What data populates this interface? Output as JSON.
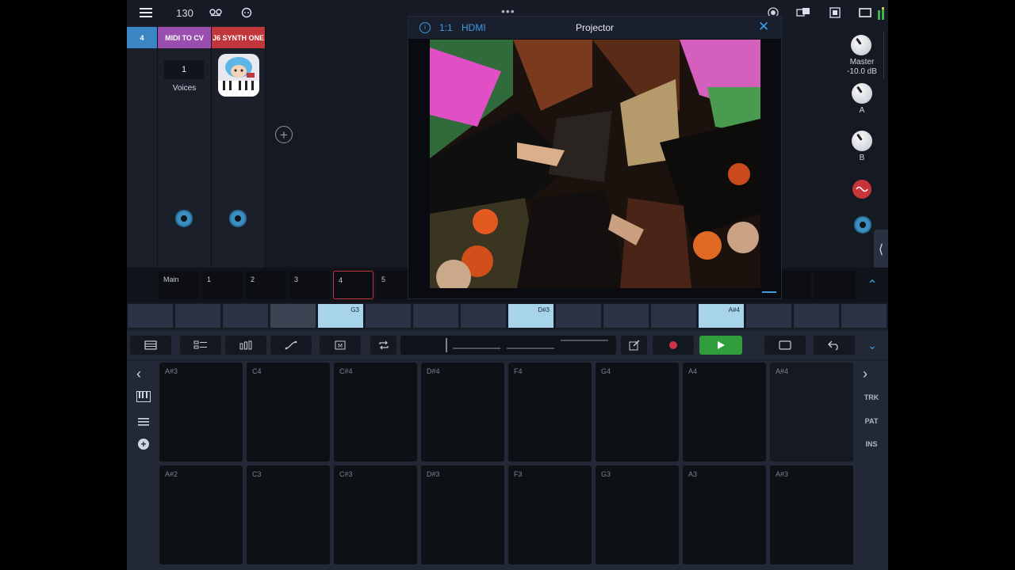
{
  "topbar": {
    "tempo": "130",
    "icons": [
      "menu-icon",
      "tape-icon",
      "clock-icon",
      "drag-handle-icon",
      "record-icon",
      "link-icon",
      "stop-icon",
      "window-icon",
      "meter-icon"
    ]
  },
  "mixer": {
    "strips": [
      {
        "header": "4",
        "color": "#3a86c3"
      },
      {
        "header": "MIDI TO CV",
        "color": "#9a4eb0"
      },
      {
        "header": "J6 SYNTH ONE",
        "color": "#c0363b"
      }
    ],
    "voices_value": "1",
    "voices_label": "Voices"
  },
  "right_panel": {
    "master_label": "Master",
    "master_value": "-10.0 dB",
    "knob_a": "A",
    "knob_b": "B"
  },
  "scenes": [
    "Main",
    "1",
    "2",
    "3",
    "4",
    "5"
  ],
  "tracks": {
    "clips": [
      "G3",
      "D#3",
      "A#4"
    ]
  },
  "projector": {
    "ratio": "1:1",
    "output": "HDMI",
    "title": "Projector"
  },
  "side": {
    "trk": "TRK",
    "pat": "PAT",
    "ins": "INS"
  },
  "pads": {
    "top": [
      "A#3",
      "C4",
      "C#4",
      "D#4",
      "F4",
      "G4",
      "A4",
      "A#4"
    ],
    "bottom": [
      "A#2",
      "C3",
      "C#3",
      "D#3",
      "F3",
      "G3",
      "A3",
      "A#3"
    ]
  },
  "colors": {
    "play": "#2e9d3a",
    "record": "#d0324b",
    "clip": "#a8d4ea",
    "accent": "#3a86c3"
  }
}
